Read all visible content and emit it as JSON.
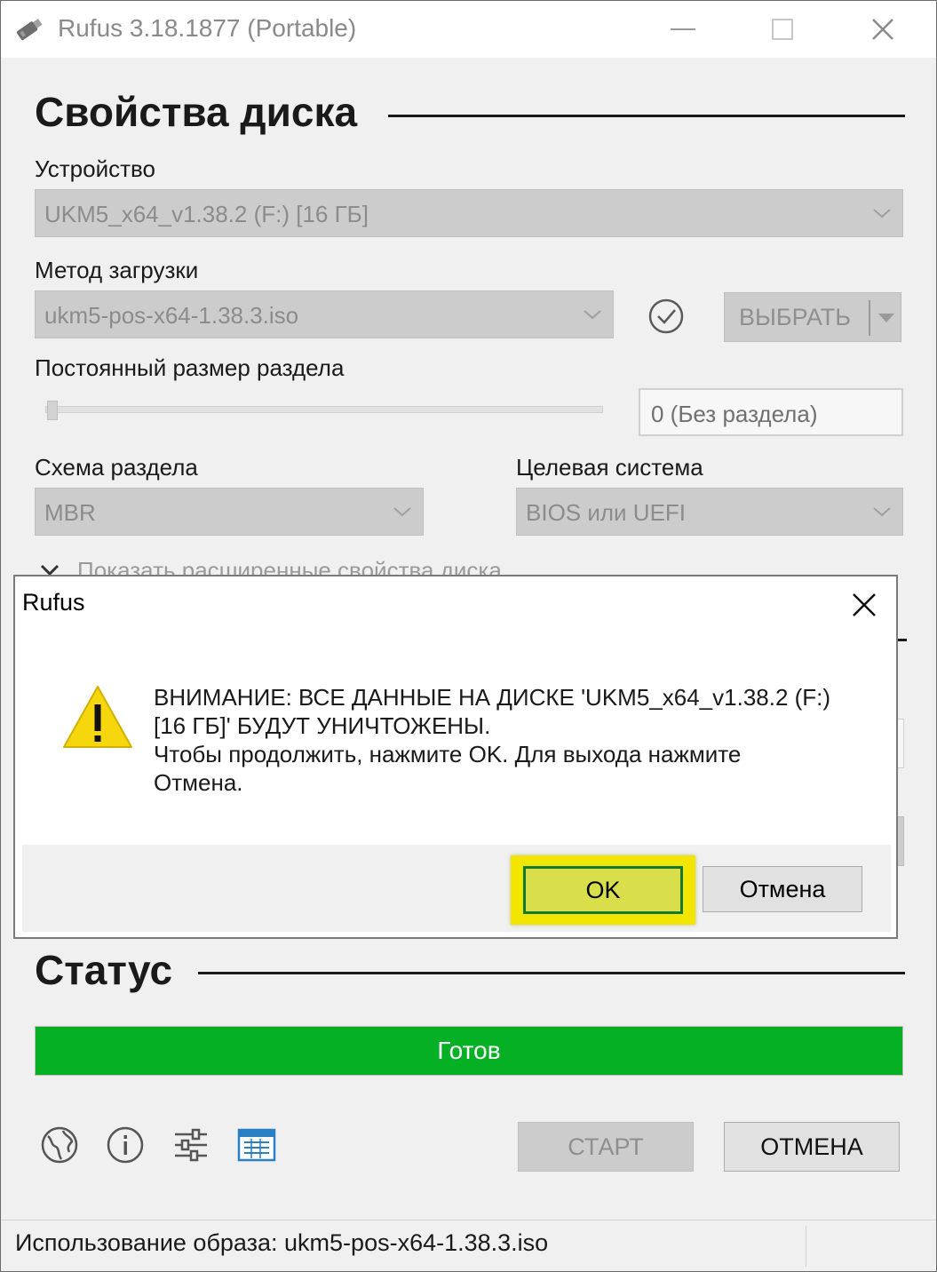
{
  "window": {
    "title": "Rufus 3.18.1877 (Portable)"
  },
  "drive_properties": {
    "heading": "Свойства диска",
    "device_label": "Устройство",
    "device_value": "UKM5_x64_v1.38.2 (F:) [16 ГБ]",
    "boot_method_label": "Метод загрузки",
    "boot_method_value": "ukm5-pos-x64-1.38.3.iso",
    "select_button": "ВЫБРАТЬ",
    "persistent_label": "Постоянный размер раздела",
    "persistent_value": "0 (Без раздела)",
    "persistent_slider_fraction": 0,
    "partition_scheme_label": "Схема раздела",
    "partition_scheme_value": "MBR",
    "target_system_label": "Целевая система",
    "target_system_value": "BIOS или UEFI",
    "advanced_toggle": "Показать расширенные свойства диска"
  },
  "dialog": {
    "title": "Rufus",
    "message_line1": "ВНИМАНИЕ: ВСЕ ДАННЫЕ НА ДИСКЕ 'UKM5_x64_v1.38.2 (F:)",
    "message_line2": "[16 ГБ]' БУДУТ УНИЧТОЖЕНЫ.",
    "message_line3": "Чтобы продолжить, нажмите OK. Для выхода нажмите",
    "message_line4": "Отмена.",
    "ok_button": "OK",
    "cancel_button": "Отмена",
    "highlight_color": "#f2e600"
  },
  "status": {
    "heading": "Статус",
    "progress_text": "Готов",
    "progress_fraction": 1,
    "progress_color": "#06b025"
  },
  "toolbar": {
    "icons": [
      "globe-icon",
      "info-icon",
      "settings-icon",
      "log-icon"
    ],
    "start_button": "СТАРТ",
    "cancel_button": "ОТМЕНА"
  },
  "statusbar": {
    "text": "Использование образа: ukm5-pos-x64-1.38.3.iso"
  }
}
